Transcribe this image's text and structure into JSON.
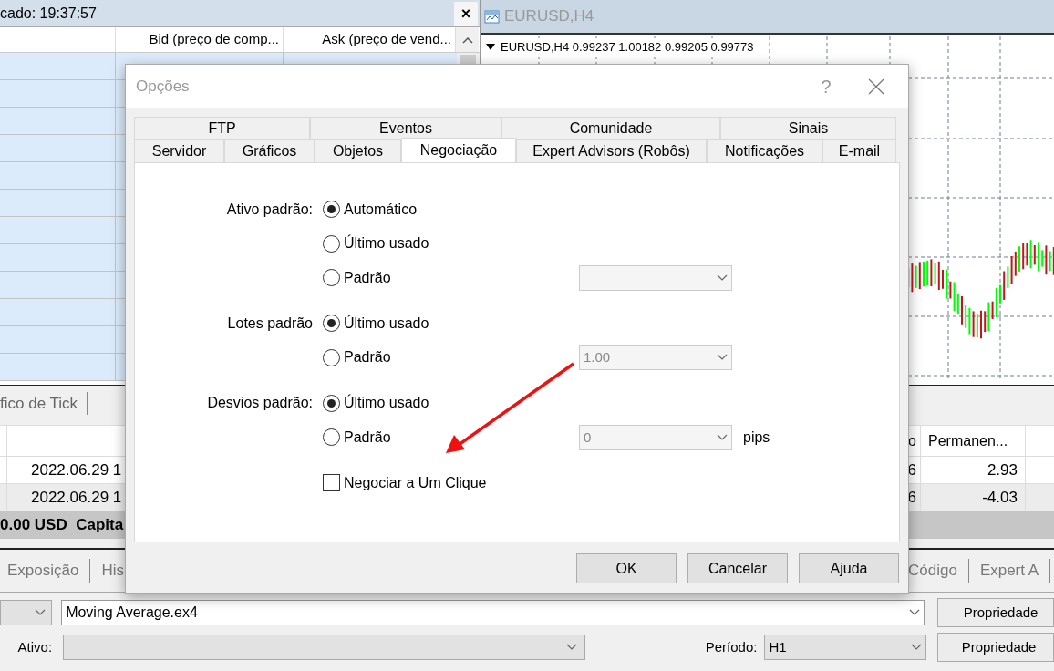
{
  "market_watch": {
    "title": "cado: 19:37:57",
    "close": "×",
    "columns": [
      "Bid (preço de comp...",
      "Ask (preço de vend..."
    ],
    "tab": "fico de Tick"
  },
  "chart": {
    "title": "EURUSD,H4",
    "info": "EURUSD,H4  0.99237 1.00182 0.99205 0.99773"
  },
  "terminal": {
    "columns": [
      "o",
      "Permanen..."
    ],
    "rows": [
      {
        "date": "2022.06.29 1",
        "column_3": "6",
        "value": "2.93"
      },
      {
        "date": "2022.06.29 1",
        "column_3": "6",
        "value": "-4.03"
      }
    ],
    "status": "0.00 USD  Capita",
    "tabs": [
      "Exposição",
      "His",
      "Código",
      "Expert A"
    ]
  },
  "tester": {
    "expert": "Moving Average.ex4",
    "properties": "Propriedade",
    "symbol_label": "Ativo:",
    "period_label": "Período:",
    "period": "H1",
    "properties_2": "Propriedade"
  },
  "dialog": {
    "title": "Opções",
    "help": "?",
    "tab_rows": [
      [
        {
          "label": "FTP",
          "selected": false
        },
        {
          "label": "Eventos",
          "selected": false
        },
        {
          "label": "Comunidade",
          "selected": false
        },
        {
          "label": "Sinais",
          "selected": false
        }
      ],
      [
        {
          "label": "Servidor",
          "selected": false
        },
        {
          "label": "Gráficos",
          "selected": false
        },
        {
          "label": "Objetos",
          "selected": false
        },
        {
          "label": "Negociação",
          "selected": true
        },
        {
          "label": "Expert Advisors (Robôs)",
          "selected": false
        },
        {
          "label": "Notificações",
          "selected": false
        },
        {
          "label": "E-mail",
          "selected": false
        }
      ]
    ],
    "groups": [
      {
        "label": "Ativo padrão:",
        "options": [
          {
            "label": "Automático",
            "selected": true
          },
          {
            "label": "Último usado",
            "selected": false
          },
          {
            "label": "Padrão",
            "selected": false,
            "dropdown": {
              "disabled": true
            }
          }
        ]
      },
      {
        "label": "Lotes padrão",
        "options": [
          {
            "label": "Último usado",
            "selected": true
          },
          {
            "label": "Padrão",
            "selected": false,
            "dropdown": {
              "value": "1.00",
              "disabled": true
            }
          }
        ]
      },
      {
        "label": "Desvios padrão:",
        "options": [
          {
            "label": "Último usado",
            "selected": true
          },
          {
            "label": "Padrão",
            "selected": false,
            "dropdown": {
              "value": "0",
              "disabled": true
            },
            "unit": "pips"
          }
        ]
      }
    ],
    "checkbox": {
      "label": "Negociar a Um Clique",
      "checked": false
    },
    "buttons": [
      "OK",
      "Cancelar",
      "Ajuda"
    ]
  }
}
